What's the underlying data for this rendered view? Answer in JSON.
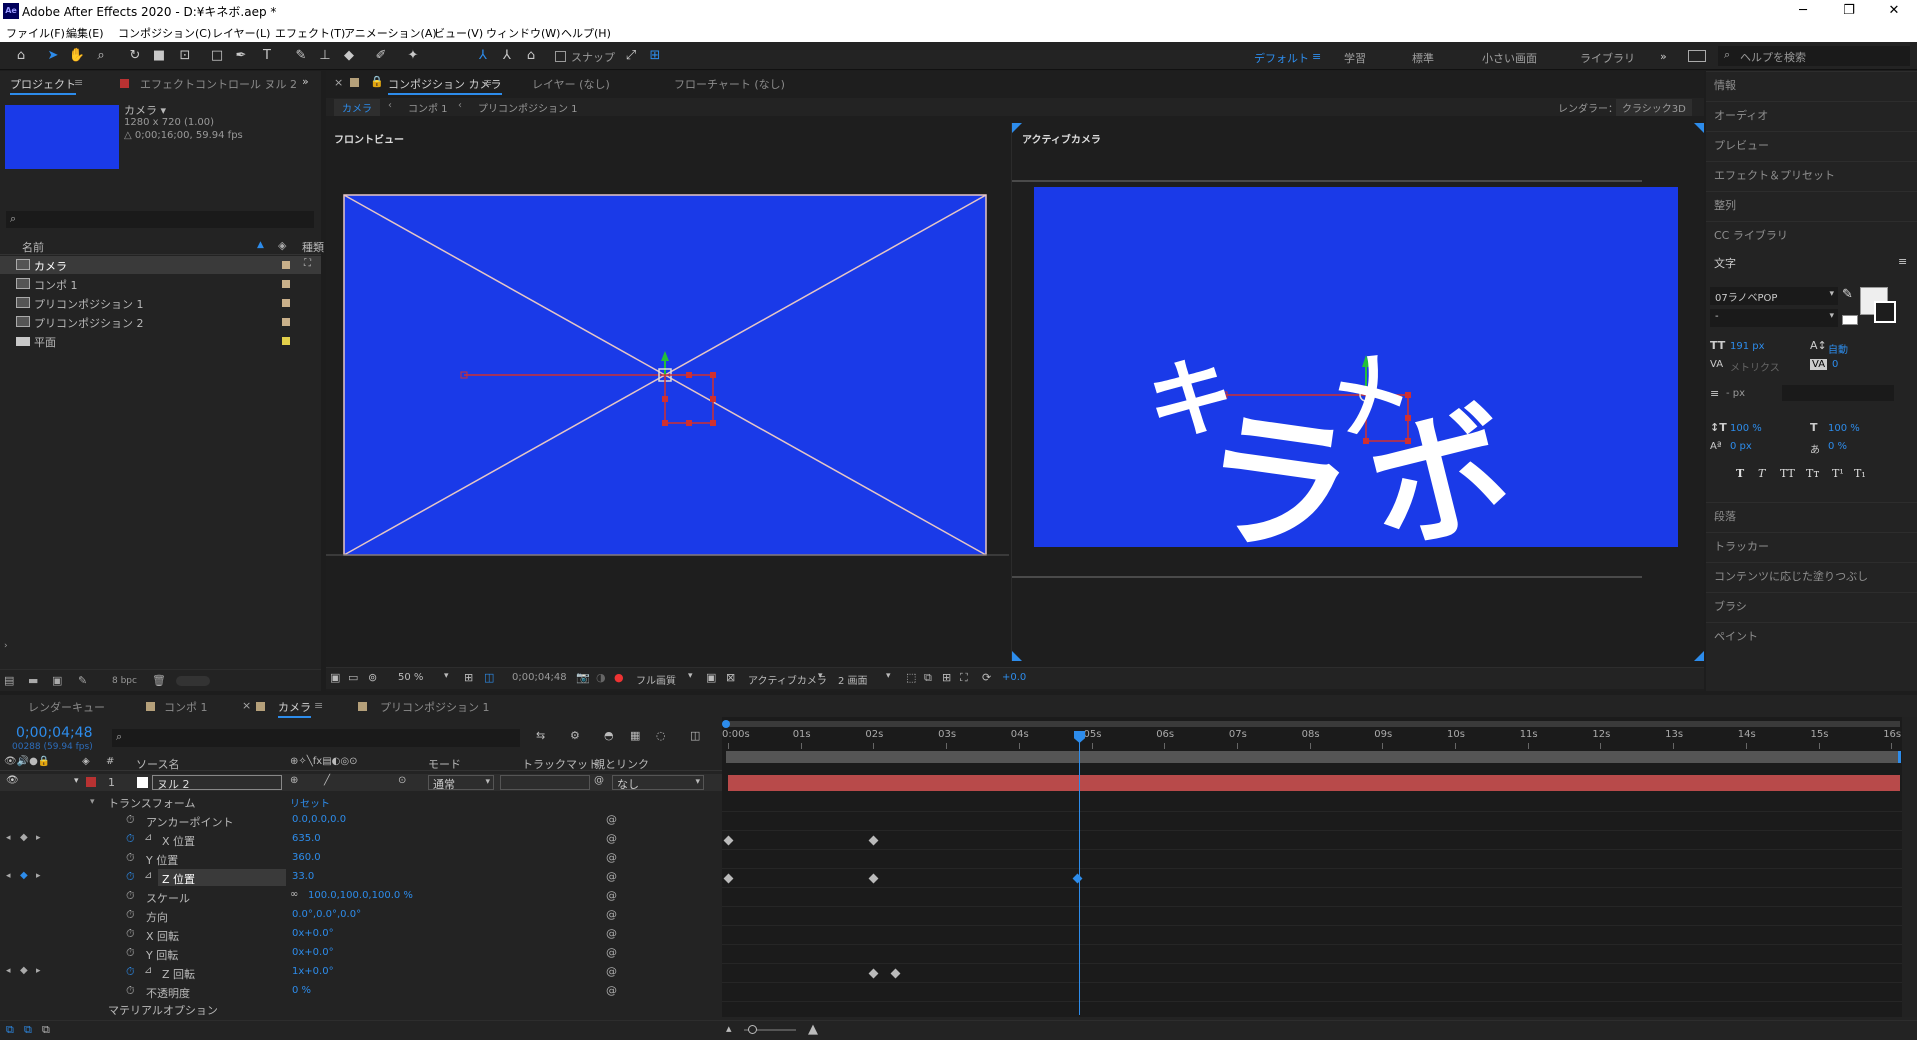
{
  "window": {
    "title": "Adobe After Effects 2020 - D:¥キネボ.aep *",
    "logo": "Ae",
    "minimize": "─",
    "maximize": "❐",
    "close": "✕"
  },
  "menu": [
    "ファイル(F)",
    "編集(E)",
    "コンポジション(C)",
    "レイヤー(L)",
    "エフェクト(T)",
    "アニメーション(A)",
    "ビュー(V)",
    "ウィンドウ(W)",
    "ヘルプ(H)"
  ],
  "toolbar": {
    "snap": "スナップ",
    "workspaces": [
      "デフォルト",
      "学習",
      "標準",
      "小さい画面",
      "ライブラリ"
    ],
    "workspace_menu": "≡",
    "more": "»",
    "help_placeholder": "ヘルプを検索"
  },
  "project": {
    "tab": "プロジェクト",
    "tab_menu": "≡",
    "effects_tab": "エフェクトコントロール ヌル 2",
    "more": "»",
    "selected_name": "カメラ ▾",
    "selected_info1": "1280 x 720 (1.00)",
    "selected_info2": "△ 0;00;16;00, 59.94 fps",
    "col_name": "名前",
    "col_type": "種類",
    "items": [
      {
        "name": "カメラ",
        "type": "comp",
        "selected": true
      },
      {
        "name": "コンポ 1",
        "type": "comp"
      },
      {
        "name": "プリコンポジション 1",
        "type": "comp"
      },
      {
        "name": "プリコンポジション 2",
        "type": "comp"
      },
      {
        "name": "平面",
        "type": "folder"
      }
    ],
    "bpc": "8 bpc"
  },
  "comp": {
    "tab": "コンポジション カメラ",
    "tab_menu": "≡",
    "layer_tab": "レイヤー (なし)",
    "flow_tab": "フローチャート (なし)",
    "breadcrumbs": [
      "カメラ",
      "コンポ 1",
      "プリコンポジション 1"
    ],
    "renderer_label": "レンダラー：",
    "renderer": "クラシック3D",
    "left_view": "フロントビュー",
    "right_view": "アクティブカメラ",
    "zoom": "50 %",
    "time": "0;00;04;48",
    "resolution": "フル画質",
    "camera": "アクティブカメラ",
    "views": "2 画面",
    "exposure": "+0.0",
    "text_content": [
      "キ",
      "メ",
      "ラ",
      "ボ"
    ]
  },
  "right_panels": [
    "情報",
    "オーディオ",
    "プレビュー",
    "エフェクト＆プリセット",
    "整列",
    "CC ライブラリ"
  ],
  "character": {
    "title": "文字",
    "menu": "≡",
    "font": "07ラノベPOP",
    "style": "-",
    "size": "191 px",
    "leading": "自動",
    "kerning": "メトリクス",
    "tracking": "0",
    "stroke_unit": "- px",
    "vscale": "100 %",
    "hscale": "100 %",
    "baseline": "0 px",
    "tsume": "0 %",
    "styles": [
      "T",
      "T",
      "TT",
      "Tт",
      "T¹",
      "T₁"
    ]
  },
  "lower_right_panels": [
    "段落",
    "トラッカー",
    "コンテンツに応じた塗りつぶし",
    "ブラシ",
    "ペイント"
  ],
  "timeline": {
    "tabs": [
      "レンダーキュー",
      "コンポ 1",
      "カメラ",
      "プリコンポジション 1"
    ],
    "tab_menu": "≡",
    "tab_close": "×",
    "timecode": "0;00;04;48",
    "frames": "00288 (59.94 fps)",
    "col_source": "ソース名",
    "col_mode": "モード",
    "col_trackmatte": "トラックマット",
    "col_parent": "親とリンク",
    "col_T": "T",
    "layer": {
      "num": "1",
      "name": "ヌル 2",
      "mode": "通常",
      "parent": "なし"
    },
    "transform": "トランスフォーム",
    "reset": "リセット",
    "props": [
      {
        "name": "アンカーポイント",
        "value": "0.0,0.0,0.0"
      },
      {
        "name": "X 位置",
        "value": "635.0"
      },
      {
        "name": "Y 位置",
        "value": "360.0"
      },
      {
        "name": "Z 位置",
        "value": "33.0"
      },
      {
        "name": "スケール",
        "value": "100.0,100.0,100.0 %"
      },
      {
        "name": "方向",
        "value": "0.0°,0.0°,0.0°"
      },
      {
        "name": "X 回転",
        "value": "0x+0.0°"
      },
      {
        "name": "Y 回転",
        "value": "0x+0.0°"
      },
      {
        "name": "Z 回転",
        "value": "1x+0.0°"
      },
      {
        "name": "不透明度",
        "value": "0 %"
      }
    ],
    "material": "マテリアルオプション",
    "ruler": [
      "0:00s",
      "01s",
      "02s",
      "03s",
      "04s",
      "05s",
      "06s",
      "07s",
      "08s",
      "09s",
      "10s",
      "11s",
      "12s",
      "13s",
      "14s",
      "15s",
      "16s"
    ]
  }
}
